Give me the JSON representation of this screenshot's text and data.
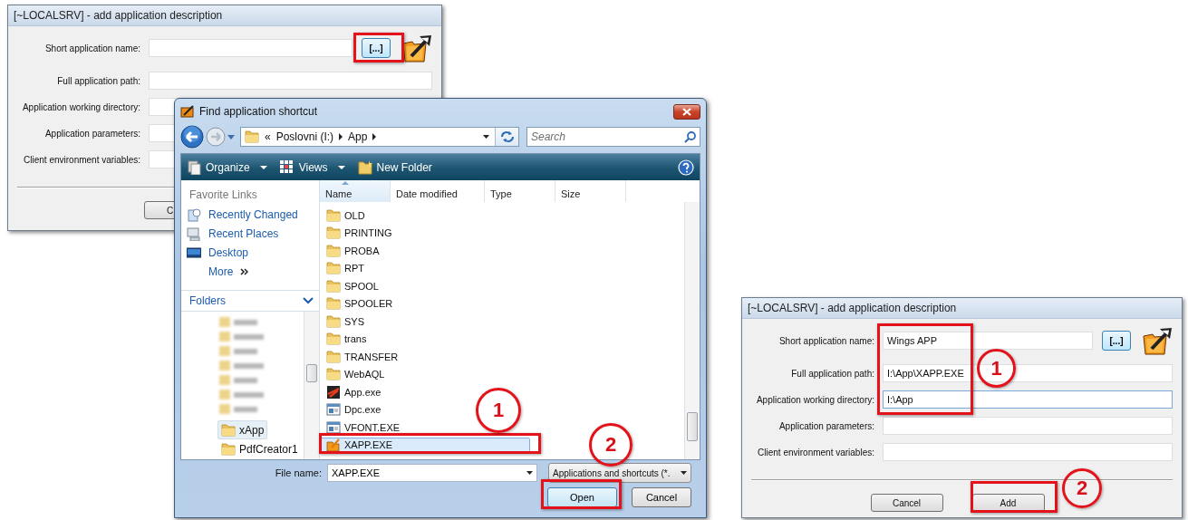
{
  "left_dialog": {
    "title": "[~LOCALSRV] - add application description",
    "fields": [
      {
        "label": "Short application name:"
      },
      {
        "label": "Full application path:"
      },
      {
        "label": "Application working directory:"
      },
      {
        "label": "Application parameters:"
      },
      {
        "label": "Client environment variables:"
      }
    ],
    "browse_button": "[...]",
    "buttons": [
      "C"
    ]
  },
  "file_dialog": {
    "title": "Find application shortcut",
    "breadcrumb": [
      "«",
      "Poslovni (I:)",
      "App"
    ],
    "search": {
      "placeholder": "Search"
    },
    "toolbar": [
      {
        "label": "Organize",
        "dropdown": true
      },
      {
        "label": "Views",
        "dropdown": true
      },
      {
        "label": "New Folder",
        "dropdown": false
      }
    ],
    "favorite_links": {
      "header": "Favorite Links",
      "items": [
        "Recently Changed",
        "Recent Places",
        "Desktop"
      ],
      "more": "More"
    },
    "folders_header": "Folders",
    "tree": [
      {
        "label": "xApp",
        "selected": true
      },
      {
        "label": "PdfCreator1",
        "selected": false
      }
    ],
    "columns": [
      {
        "label": "Name",
        "sorted": true
      },
      {
        "label": "Date modified",
        "sorted": false
      },
      {
        "label": "Type",
        "sorted": false
      },
      {
        "label": "Size",
        "sorted": false
      }
    ],
    "files": [
      {
        "name": "OLD",
        "kind": "folder",
        "selected": false
      },
      {
        "name": "PRINTING",
        "kind": "folder",
        "selected": false
      },
      {
        "name": "PROBA",
        "kind": "folder",
        "selected": false
      },
      {
        "name": "RPT",
        "kind": "folder",
        "selected": false
      },
      {
        "name": "SPOOL",
        "kind": "folder",
        "selected": false
      },
      {
        "name": "SPOOLER",
        "kind": "folder",
        "selected": false
      },
      {
        "name": "SYS",
        "kind": "folder",
        "selected": false
      },
      {
        "name": "trans",
        "kind": "folder",
        "selected": false
      },
      {
        "name": "TRANSFER",
        "kind": "folder",
        "selected": false
      },
      {
        "name": "WebAQL",
        "kind": "folder",
        "selected": false
      },
      {
        "name": "App.exe",
        "kind": "application",
        "selected": false
      },
      {
        "name": "Dpc.exe",
        "kind": "program",
        "selected": false
      },
      {
        "name": "VFONT.EXE",
        "kind": "program",
        "selected": false
      },
      {
        "name": "XAPP.EXE",
        "kind": "launcher",
        "selected": true
      }
    ],
    "file_name": {
      "label": "File name:",
      "value": "XAPP.EXE"
    },
    "file_type": "Applications and shortcuts (*.",
    "buttons": [
      "Open",
      "Cancel"
    ]
  },
  "right_dialog": {
    "title": "[~LOCALSRV] - add application description",
    "fields": [
      {
        "label": "Short application name:",
        "value": "Wings APP",
        "focused": false
      },
      {
        "label": "Full application path:",
        "value": "I:\\App\\XAPP.EXE",
        "focused": false
      },
      {
        "label": "Application working directory:",
        "value": "I:\\App",
        "focused": true
      },
      {
        "label": "Application parameters:",
        "focused": false
      },
      {
        "label": "Client environment variables:",
        "focused": false
      }
    ],
    "browse_button": "[...]",
    "buttons": [
      "Cancel",
      "Add"
    ]
  },
  "callouts": [
    {
      "kind": "frame"
    },
    {
      "kind": "frame"
    },
    {
      "kind": "circle",
      "label": "1"
    },
    {
      "kind": "circle",
      "label": "2"
    },
    {
      "kind": "frame"
    },
    {
      "kind": "frame"
    },
    {
      "kind": "circle",
      "label": "1"
    },
    {
      "kind": "frame"
    },
    {
      "kind": "circle",
      "label": "2"
    }
  ]
}
